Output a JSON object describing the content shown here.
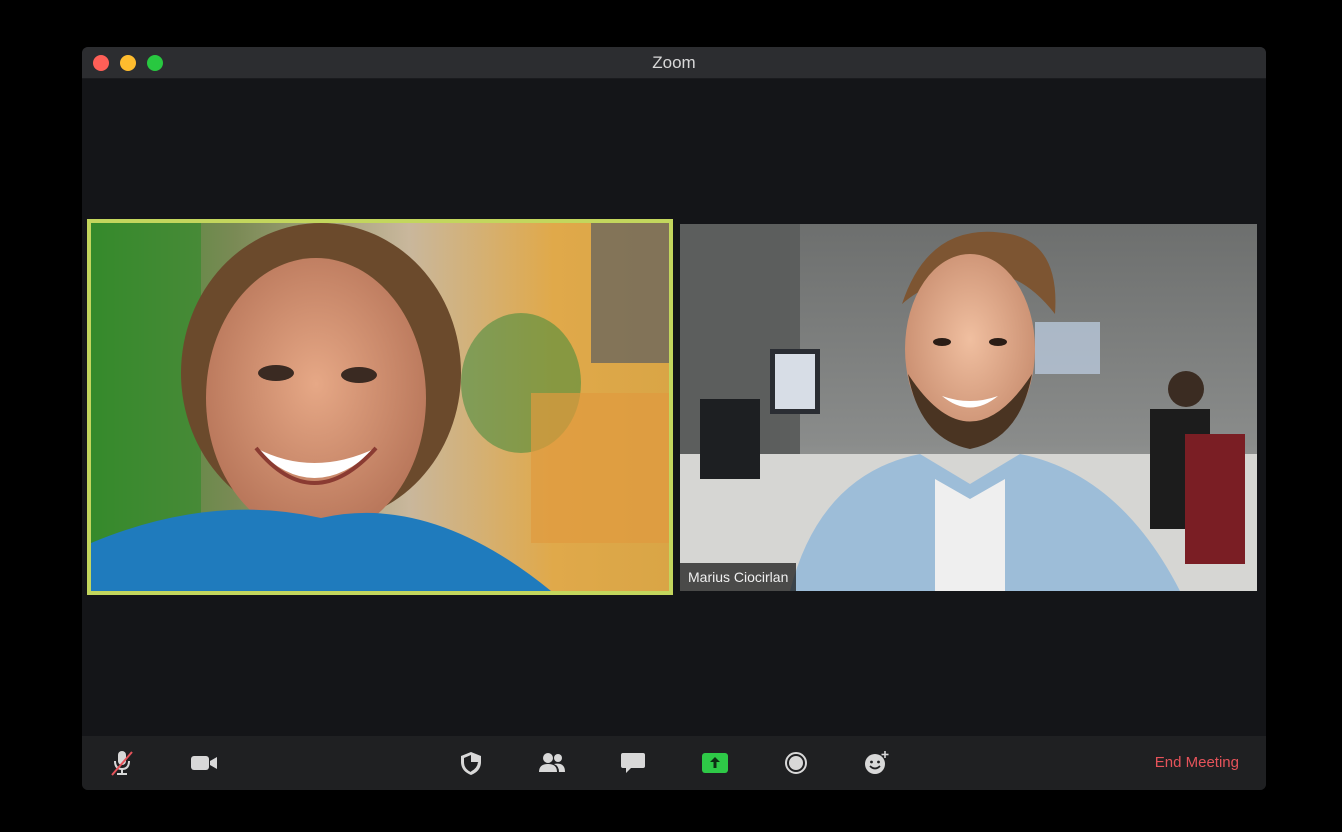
{
  "window": {
    "title": "Zoom"
  },
  "participants": [
    {
      "name": "",
      "active_speaker": true
    },
    {
      "name": "Marius Ciocirlan",
      "active_speaker": false
    }
  ],
  "toolbar": {
    "buttons": [
      {
        "id": "mute",
        "icon": "microphone-muted-icon"
      },
      {
        "id": "video",
        "icon": "video-camera-icon"
      },
      {
        "id": "security",
        "icon": "shield-icon"
      },
      {
        "id": "participants",
        "icon": "participants-icon"
      },
      {
        "id": "chat",
        "icon": "chat-bubble-icon"
      },
      {
        "id": "share-screen",
        "icon": "share-screen-icon"
      },
      {
        "id": "record",
        "icon": "record-icon"
      },
      {
        "id": "reactions",
        "icon": "reactions-icon"
      }
    ],
    "end_meeting_label": "End Meeting"
  },
  "colors": {
    "active_speaker_border": "#c3d65d",
    "share_screen_green": "#2ec947",
    "end_meeting_red": "#e5535a"
  }
}
